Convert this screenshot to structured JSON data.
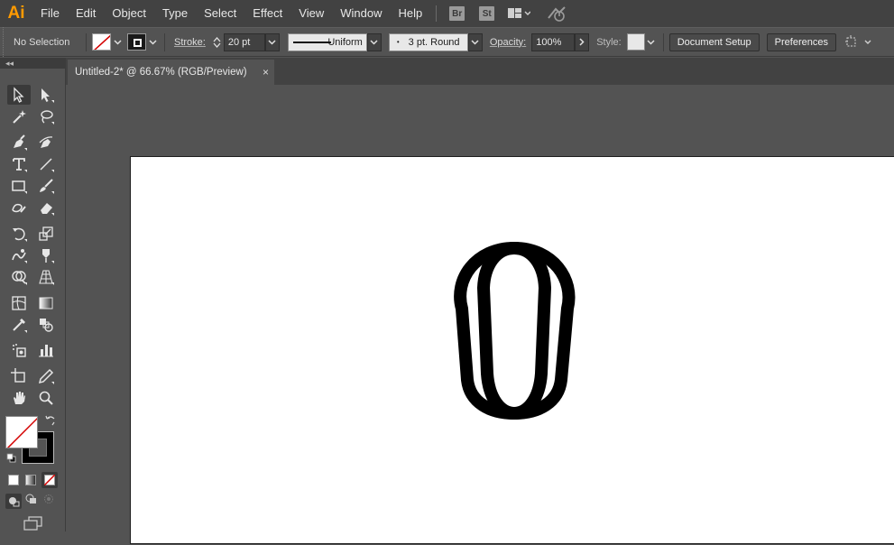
{
  "app": {
    "logo": "Ai"
  },
  "menu": [
    "File",
    "Edit",
    "Object",
    "Type",
    "Select",
    "Effect",
    "View",
    "Window",
    "Help"
  ],
  "bridge_badges": [
    "Br",
    "St"
  ],
  "control_bar": {
    "selection_status": "No Selection",
    "stroke_label": "Stroke:",
    "stroke_weight": "20 pt",
    "profile": "Uniform",
    "brush": "3 pt. Round",
    "opacity_label": "Opacity:",
    "opacity": "100%",
    "style_label": "Style:",
    "document_setup": "Document Setup",
    "preferences": "Preferences"
  },
  "document": {
    "tab_title": "Untitled-2* @ 66.67% (RGB/Preview)",
    "close_glyph": "×"
  },
  "panel": {
    "collapse_glyph": "◂◂"
  },
  "colors": {
    "accent_logo": "#ff9a00",
    "fill_none_slash": "#d40000",
    "stroke_color": "#000000"
  },
  "tools": [
    "selection-tool",
    "direct-selection-tool",
    "magic-wand-tool",
    "lasso-tool",
    "pen-tool",
    "curvature-tool",
    "type-tool",
    "line-segment-tool",
    "rectangle-tool",
    "paintbrush-tool",
    "shaper-tool",
    "eraser-tool",
    "rotate-tool",
    "scale-tool",
    "warp-tool",
    "free-transform-tool",
    "shape-builder-tool",
    "perspective-grid-tool",
    "mesh-tool",
    "gradient-tool",
    "eyedropper-tool",
    "blend-tool",
    "symbol-sprayer-tool",
    "column-graph-tool",
    "artboard-tool",
    "slice-tool",
    "hand-tool",
    "zoom-tool"
  ]
}
